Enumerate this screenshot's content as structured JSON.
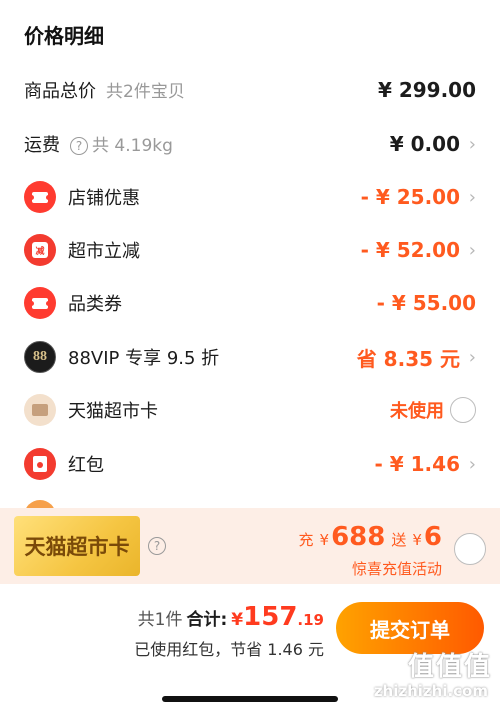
{
  "title": "价格明细",
  "rows": [
    {
      "label": "商品总价",
      "sub": "共2件宝贝",
      "value": "¥ 299.00"
    },
    {
      "label": "运费",
      "sub": "共 4.19kg",
      "value": "¥ 0.00"
    },
    {
      "label": "店铺优惠",
      "value": "- ¥ 25.00",
      "icon": "ticket-icon"
    },
    {
      "label": "超市立减",
      "value": "- ¥ 52.00",
      "icon": "supermarket-discount-icon"
    },
    {
      "label": "品类券",
      "value": "- ¥ 55.00",
      "icon": "ticket-icon"
    },
    {
      "label": "88VIP 专享 9.5 折",
      "value": "省 8.35 元",
      "icon": "vip88-icon",
      "icon_text": "88"
    },
    {
      "label": "天猫超市卡",
      "value": "未使用",
      "icon": "card-icon"
    },
    {
      "label": "红包",
      "value": "- ¥ 1.46",
      "icon": "red-envelope-icon"
    }
  ],
  "promo": {
    "badge": "天猫超市卡",
    "prefix": "充",
    "yen1": "¥",
    "amount": "688",
    "send": "送",
    "yen2": "¥",
    "bonus": "6",
    "desc": "惊喜充值活动"
  },
  "footer": {
    "count": "共1件",
    "total_label": "合计:",
    "yen": "¥",
    "total_int": "157",
    "total_dec": ".19",
    "saved": "已使用红包，节省 1.46 元",
    "submit": "提交订单"
  },
  "watermark": {
    "text": "值值值",
    "url": "zhizhizhi.com"
  },
  "colors": {
    "accent": "#ff5a1f",
    "submit_start": "#ffa200",
    "submit_end": "#ff5a00",
    "promo_bg": "#fdeee6"
  }
}
